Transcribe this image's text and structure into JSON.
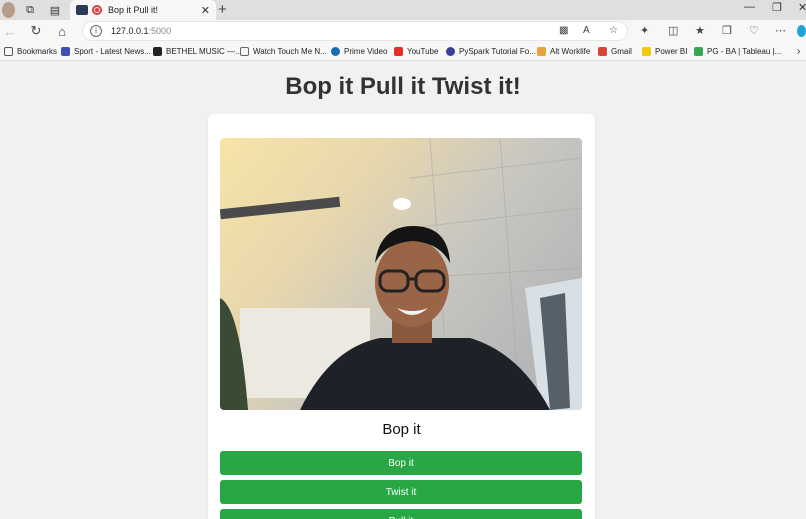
{
  "browser": {
    "tab_title": "Bop it Pull it!",
    "url_host": "127.0.0.1",
    "url_port": ":5000",
    "bookmarks": [
      {
        "label": "Bookmarks",
        "icon": "bookmark-folder-icon",
        "color": "#555555"
      },
      {
        "label": "Sport - Latest News...",
        "icon": "sport-news-icon",
        "color": "#3b4fb8"
      },
      {
        "label": "BETHEL MUSIC —...",
        "icon": "bethel-music-icon",
        "color": "#222222"
      },
      {
        "label": "Watch Touch Me N...",
        "icon": "page-icon",
        "color": "#666666"
      },
      {
        "label": "Prime Video",
        "icon": "prime-video-icon",
        "color": "#1a6bb0"
      },
      {
        "label": "YouTube",
        "icon": "youtube-icon",
        "color": "#e52d27"
      },
      {
        "label": "PySpark Tutorial Fo...",
        "icon": "pyspark-icon",
        "color": "#3a3f9a"
      },
      {
        "label": "Alt Worklife",
        "icon": "alt-worklife-icon",
        "color": "#e8a33a"
      },
      {
        "label": "Gmail",
        "icon": "gmail-icon",
        "color": "#d44638"
      },
      {
        "label": "Power BI",
        "icon": "power-bi-icon",
        "color": "#f2c811"
      },
      {
        "label": "PG - BA | Tableau |...",
        "icon": "google-drive-icon",
        "color": "#34a853"
      }
    ]
  },
  "page": {
    "title": "Bop it Pull it Twist it!",
    "current_command": "Bop it",
    "buttons": [
      {
        "label": "Bop it"
      },
      {
        "label": "Twist it"
      },
      {
        "label": "Pull it"
      }
    ],
    "accent_color": "#28a745"
  }
}
